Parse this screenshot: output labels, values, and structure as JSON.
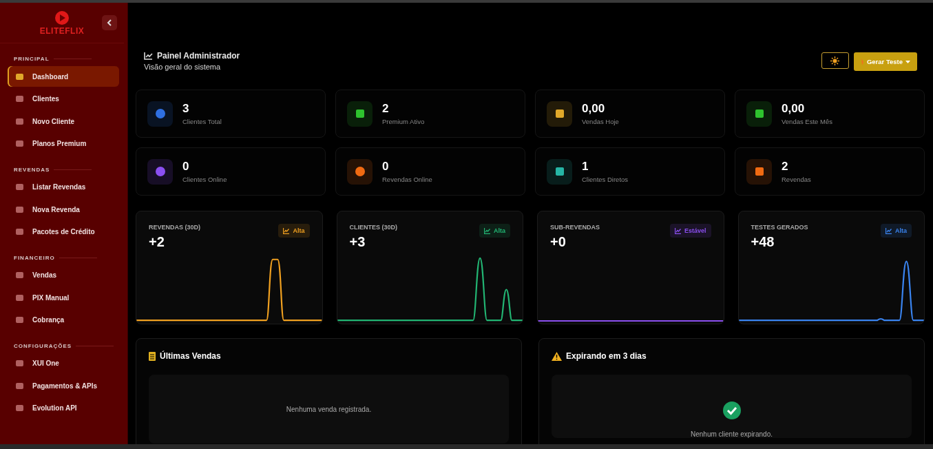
{
  "sidebar": {
    "logo_text": "ELITEFLIX",
    "sections": [
      {
        "title": "PRINCIPAL",
        "items": [
          {
            "label": "Dashboard",
            "selected": true
          },
          {
            "label": "Clientes",
            "selected": false
          },
          {
            "label": "Novo Cliente",
            "selected": false
          },
          {
            "label": "Planos Premium",
            "selected": false
          }
        ]
      },
      {
        "title": "REVENDAS",
        "items": [
          {
            "label": "Listar Revendas",
            "selected": false
          },
          {
            "label": "Nova Revenda",
            "selected": false
          },
          {
            "label": "Pacotes de Crédito",
            "selected": false
          }
        ]
      },
      {
        "title": "FINANCEIRO",
        "items": [
          {
            "label": "Vendas",
            "selected": false
          },
          {
            "label": "PIX Manual",
            "selected": false
          },
          {
            "label": "Cobrança",
            "selected": false
          }
        ]
      },
      {
        "title": "CONFIGURAÇÕES",
        "items": [
          {
            "label": "XUI One",
            "selected": false
          },
          {
            "label": "Pagamentos & APIs",
            "selected": false
          },
          {
            "label": "Evolution API",
            "selected": false
          }
        ]
      }
    ]
  },
  "header": {
    "title": "Painel Administrador",
    "subtitle": "Visão geral do sistema",
    "generate_button": "Gerar Teste"
  },
  "stats": [
    {
      "value": "3",
      "label": "Clientes Total",
      "color": "#2f6fe0"
    },
    {
      "value": "2",
      "label": "Premium Ativo",
      "color": "#2ec22e"
    },
    {
      "value": "0,00",
      "label": "Vendas Hoje",
      "color": "#e0a82a"
    },
    {
      "value": "0,00",
      "label": "Vendas Este Mês",
      "color": "#2ec22e"
    },
    {
      "value": "0",
      "label": "Clientes Online",
      "color": "#8b4ff0"
    },
    {
      "value": "0",
      "label": "Revendas Online",
      "color": "#f06a12"
    },
    {
      "value": "1",
      "label": "Clientes Diretos",
      "color": "#26b5a5"
    },
    {
      "value": "2",
      "label": "Revendas",
      "color": "#f06a12"
    }
  ],
  "trends": [
    {
      "title": "REVENDAS (30D)",
      "value": "+2",
      "badge": "Alta",
      "color": "#f0a020"
    },
    {
      "title": "CLIENTES (30D)",
      "value": "+3",
      "badge": "Alta",
      "color": "#22b573"
    },
    {
      "title": "SUB-REVENDAS",
      "value": "+0",
      "badge": "Estável",
      "color": "#8b4ff0"
    },
    {
      "title": "TESTES GERADOS",
      "value": "+48",
      "badge": "Alta",
      "color": "#3a84f0"
    }
  ],
  "panels": [
    {
      "title": "Últimas Vendas",
      "empty_text": "Nenhuma venda registrada.",
      "kind": "sales"
    },
    {
      "title": "Expirando em 3 dias",
      "empty_text": "Nenhum cliente expirando.",
      "kind": "expiring"
    }
  ]
}
